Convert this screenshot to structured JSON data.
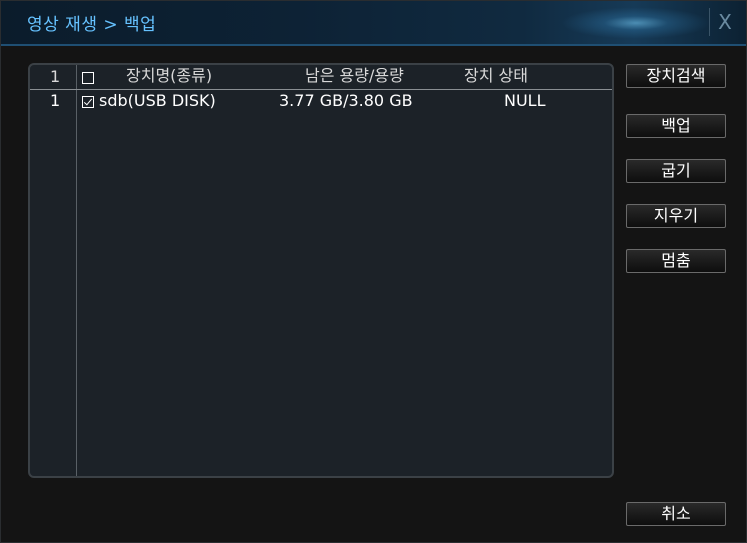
{
  "window": {
    "title": "영상 재생 > 백업",
    "close_label": "X"
  },
  "table": {
    "header": {
      "index": "1",
      "device_name": "장치명(종류)",
      "remaining": "남은 용량/용량",
      "status": "장치 상태"
    },
    "rows": [
      {
        "index": "1",
        "checked": true,
        "device_name": "sdb(USB DISK)",
        "capacity": "3.77 GB/3.80 GB",
        "status": "NULL"
      }
    ]
  },
  "buttons": {
    "search": "장치검색",
    "backup": "백업",
    "burn": "굽기",
    "erase": "지우기",
    "stop": "멈춤",
    "cancel": "취소"
  },
  "colors": {
    "title_text": "#66c2ff",
    "title_bar_border": "#1f4f73",
    "window_bg": "#141414",
    "panel_bg": "#1c2228"
  }
}
